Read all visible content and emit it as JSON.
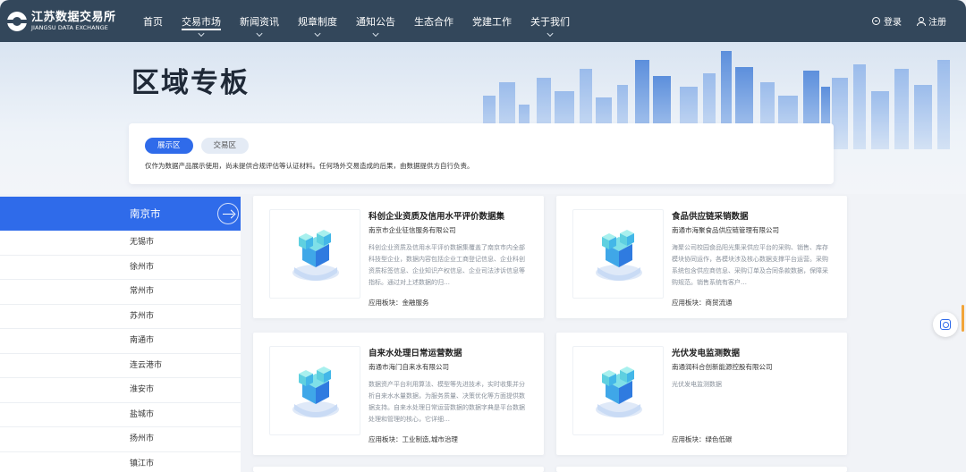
{
  "nav": {
    "logo_cn": "江苏数据交易所",
    "logo_en": "JIANGSU DATA EXCHANGE",
    "items": [
      {
        "label": "首页",
        "has_chevron": false,
        "active": false
      },
      {
        "label": "交易市场",
        "has_chevron": true,
        "active": true
      },
      {
        "label": "新闻资讯",
        "has_chevron": true,
        "active": false
      },
      {
        "label": "规章制度",
        "has_chevron": true,
        "active": false
      },
      {
        "label": "通知公告",
        "has_chevron": true,
        "active": false
      },
      {
        "label": "生态合作",
        "has_chevron": false,
        "active": false
      },
      {
        "label": "党建工作",
        "has_chevron": false,
        "active": false
      },
      {
        "label": "关于我们",
        "has_chevron": true,
        "active": false
      }
    ],
    "login_label": "登录",
    "register_label": "注册"
  },
  "hero": {
    "title": "区域专板"
  },
  "region": {
    "tabs": [
      {
        "label": "展示区",
        "active": true
      },
      {
        "label": "交易区",
        "active": false
      }
    ],
    "notice": "仅作为数据产品展示使用，尚未提供合规评估等认证材料。任何场外交易造成的后果，由数据提供方自行负责。"
  },
  "sidebar": {
    "cities": [
      "南京市",
      "无锡市",
      "徐州市",
      "常州市",
      "苏州市",
      "南通市",
      "连云港市",
      "淮安市",
      "盐城市",
      "扬州市",
      "镇江市"
    ],
    "active_index": 0
  },
  "cards": [
    {
      "title": "科创企业资质及信用水平评价数据集",
      "company": "南京市企业征信服务有限公司",
      "desc": "科创企业资质及信用水平评价数据集覆盖了南京市内全部科技型企业，数据内容包括企业工商登记信息、企业科创资质标签信息、企业知识产权信息、企业司法涉诉信息等指标。通过对上述数据的归…",
      "sector": "应用板块：金融服务"
    },
    {
      "title": "食品供应链采销数据",
      "company": "南通市海聚食品供应链管理有限公司",
      "desc": "海聚公司校园食品阳光集采供应平台的采购、销售、库存模块协同运作，各模块涉及核心数据支撑平台运营。采购系统包含供应商信息、采购订单及合同条款数据，保障采购规范。销售系统有客户…",
      "sector": "应用板块：商贸流通"
    },
    {
      "title": "自来水处理日常运营数据",
      "company": "南通市海门自来水有限公司",
      "desc": "数据资产平台利用算法、模型等先进技术，实时收集并分析自来水水量数据，为服务质量、决策优化等方面提供数据支持。自来水处理日常运营数据的数据字典是平台数据处理和管理的核心，它详细…",
      "sector": "应用板块：工业制造,城市治理"
    },
    {
      "title": "光伏发电监测数据",
      "company": "南通润科合创新能源控股有限公司",
      "desc": "光伏发电监测数据",
      "sector": "应用板块：绿色低碳"
    }
  ]
}
